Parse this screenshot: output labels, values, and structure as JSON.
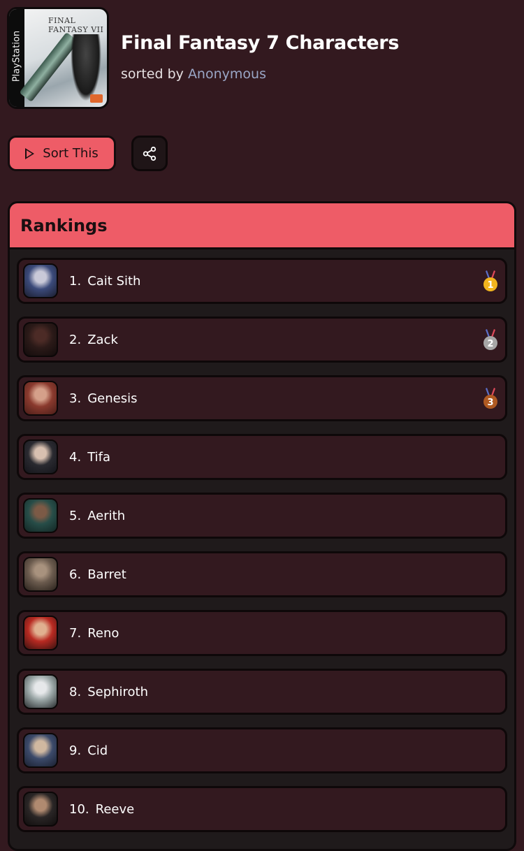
{
  "header": {
    "title": "Final Fantasy 7 Characters",
    "sorted_by_label": "sorted by",
    "author": "Anonymous",
    "cover": {
      "platform_text": "PlayStation",
      "logo_text": "FINAL FANTASY VII"
    }
  },
  "actions": {
    "sort_label": "Sort This",
    "share_icon": "share-icon"
  },
  "rankings": {
    "title": "Rankings",
    "items": [
      {
        "rank": "1.",
        "name": "Cait Sith",
        "medal": "gold",
        "colors": [
          "#3b4a7a",
          "#c9c9d8",
          "#1b1d2e"
        ]
      },
      {
        "rank": "2.",
        "name": "Zack",
        "medal": "silver",
        "colors": [
          "#2b1a18",
          "#4c2b26",
          "#120b0b"
        ]
      },
      {
        "rank": "3.",
        "name": "Genesis",
        "medal": "bronze",
        "colors": [
          "#8a3a2e",
          "#d5a08a",
          "#4a1d18"
        ]
      },
      {
        "rank": "4.",
        "name": "Tifa",
        "medal": "",
        "colors": [
          "#2a2a30",
          "#d8c0b0",
          "#14141a"
        ]
      },
      {
        "rank": "5.",
        "name": "Aerith",
        "medal": "",
        "colors": [
          "#274d48",
          "#7c5a46",
          "#122624"
        ]
      },
      {
        "rank": "6.",
        "name": "Barret",
        "medal": "",
        "colors": [
          "#6b5b4e",
          "#a8927e",
          "#2a221c"
        ]
      },
      {
        "rank": "7.",
        "name": "Reno",
        "medal": "",
        "colors": [
          "#b82a22",
          "#e0b090",
          "#3a1210"
        ]
      },
      {
        "rank": "8.",
        "name": "Sephiroth",
        "medal": "",
        "colors": [
          "#9aa6a6",
          "#e6e8ea",
          "#2a2e30"
        ]
      },
      {
        "rank": "9.",
        "name": "Cid",
        "medal": "",
        "colors": [
          "#3c4a6a",
          "#d0b8a0",
          "#1a2030"
        ]
      },
      {
        "rank": "10.",
        "name": "Reeve",
        "medal": "",
        "colors": [
          "#2a2626",
          "#b08a70",
          "#100d0d"
        ]
      }
    ]
  },
  "colors": {
    "background": "#33191f",
    "accent": "#ee5c67",
    "author": "#9aa6c6",
    "gold": "#f2b51e",
    "silver": "#a7a7a7",
    "bronze": "#b05a22"
  }
}
